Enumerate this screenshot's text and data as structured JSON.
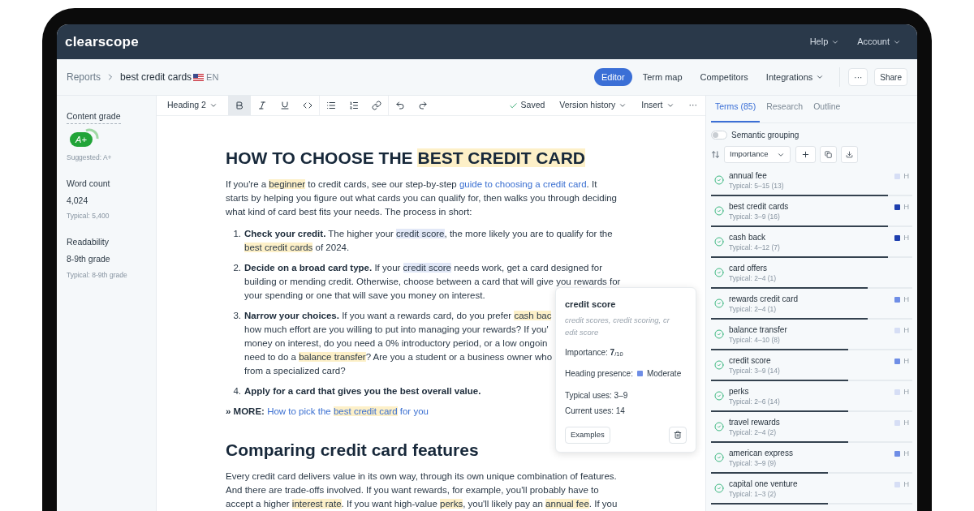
{
  "app": {
    "logo": "clearscope",
    "menus": [
      {
        "label": "Help"
      },
      {
        "label": "Account"
      }
    ]
  },
  "breadcrumb": {
    "parent": "Reports",
    "current": "best credit cards",
    "language": "EN"
  },
  "view_tabs": [
    {
      "label": "Editor",
      "selected": true,
      "dropdown": false
    },
    {
      "label": "Term map",
      "selected": false,
      "dropdown": false
    },
    {
      "label": "Competitors",
      "selected": false,
      "dropdown": false
    },
    {
      "label": "Integrations",
      "selected": false,
      "dropdown": true
    }
  ],
  "header_actions": {
    "more": "···",
    "share": "Share"
  },
  "sidebar": {
    "content_grade": {
      "label": "Content grade",
      "grade": "A+",
      "suggested": "Suggested: A+"
    },
    "stats": [
      {
        "label": "Word count",
        "value": "4,024",
        "typical": "Typical: 5,400"
      },
      {
        "label": "Readability",
        "value": "8-9th grade",
        "typical": "Typical: 8-9th grade"
      }
    ]
  },
  "toolbar": {
    "block_style": "Heading 2",
    "format_buttons": [
      {
        "kind": "bold",
        "selected": true
      },
      {
        "kind": "italic",
        "selected": false
      },
      {
        "kind": "underline",
        "selected": false
      },
      {
        "kind": "code",
        "selected": false
      },
      {
        "kind": "bullets",
        "selected": false
      },
      {
        "kind": "numbers",
        "selected": false
      },
      {
        "kind": "link",
        "selected": false
      },
      {
        "kind": "undo",
        "selected": false
      },
      {
        "kind": "redo",
        "selected": false
      }
    ],
    "status": "Saved",
    "version_history": "Version history",
    "insert": "Insert",
    "more": "···"
  },
  "document": [
    {
      "kind": "h1",
      "lines": [
        [
          {
            "t": "HOW TO CHOOSE THE "
          },
          {
            "t": "BEST CREDIT CARD",
            "kind": "term"
          }
        ]
      ]
    },
    {
      "kind": "p",
      "lines": [
        [
          {
            "t": "If you're a "
          },
          {
            "t": "beginner",
            "kind": "term"
          },
          {
            "t": " to credit cards, see our step-by-step "
          },
          {
            "kind": "link",
            "parts": [
              {
                "t": "guide to choosing a credit card"
              }
            ]
          },
          {
            "t": ". It"
          }
        ],
        [
          {
            "t": "starts by helping you figure out what cards you can qualify for, then walks you through deciding"
          }
        ],
        [
          {
            "t": "what kind of card best fits your needs. The process in short:"
          }
        ]
      ]
    },
    {
      "kind": "li",
      "number": "1.",
      "lines": [
        [
          {
            "t": "Check your credit.",
            "kind": "bold"
          },
          {
            "t": " The higher your "
          },
          {
            "t": "credit score",
            "kind": "active_term"
          },
          {
            "t": ", the more likely you are to qualify for the"
          }
        ],
        [
          {
            "t": "best credit cards",
            "kind": "term"
          },
          {
            "t": " of 2024."
          }
        ]
      ]
    },
    {
      "kind": "li",
      "number": "2.",
      "lines": [
        [
          {
            "t": "Decide on a broad card type.",
            "kind": "bold"
          },
          {
            "t": " If your "
          },
          {
            "t": "credit score",
            "kind": "active_term"
          },
          {
            "t": " needs work, get a card designed for"
          }
        ],
        [
          {
            "t": "building or mending credit. Otherwise, choose between a card that will give you rewards for"
          }
        ],
        [
          {
            "t": "your spending or one that will save you money on interest."
          }
        ]
      ]
    },
    {
      "kind": "li",
      "number": "3.",
      "lines": [
        [
          {
            "t": "Narrow your choices.",
            "kind": "bold"
          },
          {
            "t": " If you want a rewards card, do you prefer "
          },
          {
            "t": "cash bac",
            "kind": "term"
          }
        ],
        [
          {
            "t": "how much effort are you willing to put into managing your rewards? If you'"
          }
        ],
        [
          {
            "t": "money on interest, do you need a 0% introductory period, or a low ongoin"
          }
        ],
        [
          {
            "t": "need to do a "
          },
          {
            "t": "balance transfer",
            "kind": "term"
          },
          {
            "t": "? Are you a student or a business owner who"
          }
        ],
        [
          {
            "t": "from a specialized card?"
          }
        ]
      ]
    },
    {
      "kind": "li",
      "number": "4.",
      "lines": [
        [
          {
            "t": "Apply for a card that gives you the best overall value.",
            "kind": "bold"
          }
        ]
      ]
    },
    {
      "kind": "p",
      "lines": [
        [
          {
            "t": "» MORE: ",
            "kind": "bold"
          },
          {
            "kind": "link",
            "parts": [
              {
                "t": "How to pick the "
              },
              {
                "t": "best credit card",
                "kind": "term"
              },
              {
                "t": " for you"
              }
            ]
          }
        ]
      ]
    },
    {
      "kind": "h2",
      "lines": [
        [
          {
            "t": "Comparing credit card features"
          }
        ]
      ]
    },
    {
      "kind": "p",
      "lines": [
        [
          {
            "t": "Every credit card delivers value in its own way, through its own unique combination of features."
          }
        ],
        [
          {
            "t": "And there are trade-offs involved. If you want rewards, for example, you'll probably have to"
          }
        ],
        [
          {
            "t": "accept a higher "
          },
          {
            "t": "interest rate",
            "kind": "term"
          },
          {
            "t": ". If you want high-value "
          },
          {
            "t": "perks",
            "kind": "term"
          },
          {
            "t": ", you'll likely pay an "
          },
          {
            "t": "annual fee",
            "kind": "term"
          },
          {
            "t": ". If you"
          }
        ]
      ]
    }
  ],
  "popover": {
    "term": "credit score",
    "variants": [
      "credit scores, credit scoring, cr",
      "edit score"
    ],
    "importance": "Importance: **7**$_{/10}$",
    "heading_presence_label": "Heading presence:",
    "heading_presence": "Moderate",
    "color": "#6f8ee6",
    "typical_uses": "Typical uses: 3–9",
    "current_uses": "Current uses: 14",
    "examples": "Examples"
  },
  "panel": {
    "tabs": [
      {
        "label": "Terms (85)",
        "selected": true
      },
      {
        "label": "Research",
        "selected": false
      },
      {
        "label": "Outline",
        "selected": false
      }
    ],
    "semantic_grouping": {
      "label": "Semantic grouping",
      "on": false
    },
    "sort": "Importance",
    "terms": [
      {
        "name": "annual fee",
        "typical": "Typical: 5–15 (13)",
        "done": true,
        "heading": "H",
        "color": "#d6def5",
        "level": 0.88
      },
      {
        "name": "best credit cards",
        "typical": "Typical: 3–9 (16)",
        "done": true,
        "heading": "H",
        "color": "#1e3fae",
        "level": 0.88
      },
      {
        "name": "cash back",
        "typical": "Typical: 4–12 (7)",
        "done": true,
        "heading": "H",
        "color": "#1e3fae",
        "level": 0.88
      },
      {
        "name": "card offers",
        "typical": "Typical: 2–4 (1)",
        "done": true,
        "level": 0.78
      },
      {
        "name": "rewards credit card",
        "typical": "Typical: 2–4 (1)",
        "done": true,
        "heading": "H",
        "color": "#6f8ee6",
        "level": 0.78
      },
      {
        "name": "balance transfer",
        "typical": "Typical: 4–10 (8)",
        "done": true,
        "heading": "H",
        "color": "#d6def5",
        "level": 0.68
      },
      {
        "name": "credit score",
        "typical": "Typical: 3–9 (14)",
        "done": true,
        "heading": "H",
        "color": "#6f8ee6",
        "level": 0.68
      },
      {
        "name": "perks",
        "typical": "Typical: 2–6 (14)",
        "done": true,
        "heading": "H",
        "color": "#d6def5",
        "level": 0.68
      },
      {
        "name": "travel rewards",
        "typical": "Typical: 2–4 (2)",
        "done": true,
        "heading": "H",
        "color": "#d6def5",
        "level": 0.68
      },
      {
        "name": "american express",
        "typical": "Typical: 3–9 (9)",
        "done": true,
        "heading": "H",
        "color": "#6f8ee6",
        "level": 0.58
      },
      {
        "name": "capital one venture",
        "typical": "Typical: 1–3 (2)",
        "done": true,
        "heading": "H",
        "color": "#d6def5",
        "level": 0.58
      }
    ]
  }
}
